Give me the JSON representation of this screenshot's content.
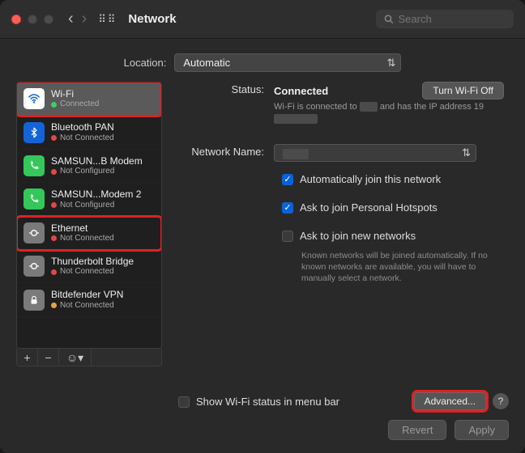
{
  "header": {
    "title": "Network",
    "search_placeholder": "Search"
  },
  "location": {
    "label": "Location:",
    "value": "Automatic"
  },
  "sidebar": {
    "items": [
      {
        "name": "Wi-Fi",
        "status": "Connected",
        "dot": "green",
        "icon_bg": "#ffffff",
        "icon_fg": "#1a6fd6",
        "icon": "wifi",
        "selected": true,
        "highlight": true
      },
      {
        "name": "Bluetooth PAN",
        "status": "Not Connected",
        "dot": "red",
        "icon_bg": "#1464d8",
        "icon_fg": "#fff",
        "icon": "bluetooth"
      },
      {
        "name": "SAMSUN...B Modem",
        "status": "Not Configured",
        "dot": "red",
        "icon_bg": "#34c759",
        "icon_fg": "#fff",
        "icon": "phone"
      },
      {
        "name": "SAMSUN...Modem 2",
        "status": "Not Configured",
        "dot": "red",
        "icon_bg": "#34c759",
        "icon_fg": "#fff",
        "icon": "phone"
      },
      {
        "name": "Ethernet",
        "status": "Not Connected",
        "dot": "red",
        "icon_bg": "#7a7a7a",
        "icon_fg": "#fff",
        "icon": "ethernet",
        "highlight": true
      },
      {
        "name": "Thunderbolt Bridge",
        "status": "Not Connected",
        "dot": "red",
        "icon_bg": "#7a7a7a",
        "icon_fg": "#fff",
        "icon": "ethernet"
      },
      {
        "name": "Bitdefender VPN",
        "status": "Not Connected",
        "dot": "orange",
        "icon_bg": "#7a7a7a",
        "icon_fg": "#fff",
        "icon": "lock"
      }
    ],
    "actions": {
      "add": "+",
      "remove": "−",
      "more": "☺︎▾"
    }
  },
  "detail": {
    "status_label": "Status:",
    "status_value": "Connected",
    "turn_off": "Turn Wi-Fi Off",
    "status_desc_pre": "Wi-Fi is connected to ",
    "status_desc_mid": " and has the IP address 19",
    "network_name_label": "Network Name:",
    "auto_join": "Automatically join this network",
    "ask_hotspots": "Ask to join Personal Hotspots",
    "ask_new": "Ask to join new networks",
    "ask_new_hint": "Known networks will be joined automatically. If no known networks are available, you will have to manually select a network.",
    "show_menu": "Show Wi-Fi status in menu bar",
    "advanced": "Advanced...",
    "help": "?"
  },
  "footer": {
    "revert": "Revert",
    "apply": "Apply"
  },
  "colors": {
    "highlight": "#d22"
  }
}
